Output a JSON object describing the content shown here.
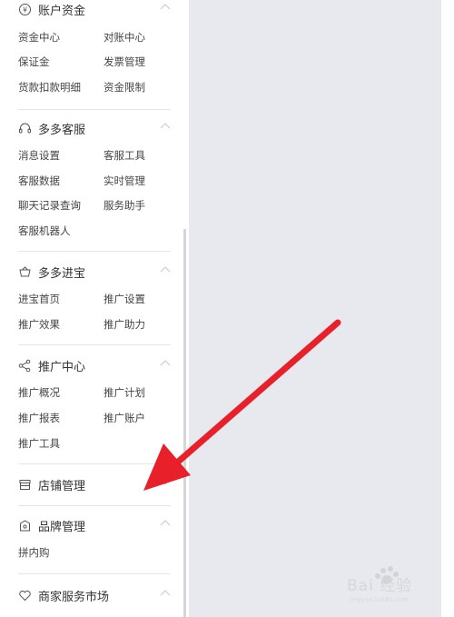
{
  "sidebar": {
    "sections": [
      {
        "title": "账户资金",
        "icon": "yen-icon",
        "items": [
          "资金中心",
          "对账中心",
          "保证金",
          "发票管理",
          "货款扣款明细",
          "资金限制"
        ]
      },
      {
        "title": "多多客服",
        "icon": "headset-icon",
        "items": [
          "消息设置",
          "客服工具",
          "客服数据",
          "实时管理",
          "聊天记录查询",
          "服务助手",
          "客服机器人"
        ]
      },
      {
        "title": "多多进宝",
        "icon": "treasure-icon",
        "items": [
          "进宝首页",
          "推广设置",
          "推广效果",
          "推广助力"
        ]
      },
      {
        "title": "推广中心",
        "icon": "share-icon",
        "items": [
          "推广概况",
          "推广计划",
          "推广报表",
          "推广账户",
          "推广工具"
        ]
      },
      {
        "title": "店铺管理",
        "icon": "store-icon",
        "items": []
      },
      {
        "title": "品牌管理",
        "icon": "brand-icon",
        "items": [
          "拼内购"
        ]
      },
      {
        "title": "商家服务市场",
        "icon": "heart-icon",
        "items": []
      }
    ]
  },
  "colors": {
    "annotation_arrow": "#e8202a",
    "content_bg": "#e8e9ee"
  },
  "watermark": {
    "text": "Bai 经验",
    "sub": "jingyan.baidu.com"
  }
}
